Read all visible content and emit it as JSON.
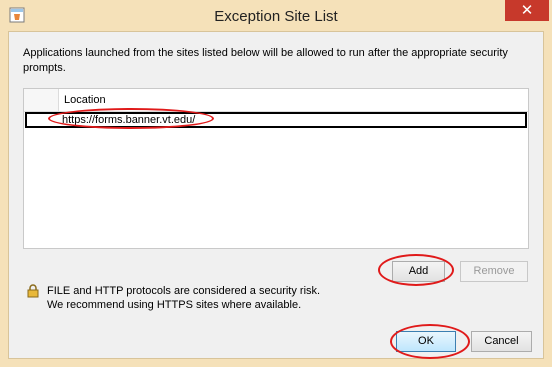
{
  "window": {
    "title": "Exception Site List",
    "close_glyph": "✕",
    "app_icon": "java-app-icon"
  },
  "description": "Applications launched from the sites listed below will be allowed to run after the appropriate security prompts.",
  "table": {
    "columns": [
      "Location"
    ],
    "rows": [
      {
        "location": "https://forms.banner.vt.edu/"
      }
    ]
  },
  "buttons": {
    "add": "Add",
    "remove": "Remove",
    "ok": "OK",
    "cancel": "Cancel"
  },
  "warning": {
    "icon": "padlock-icon",
    "line1": "FILE and HTTP protocols are considered a security risk.",
    "line2": "We recommend using HTTPS sites where available."
  },
  "colors": {
    "frame": "#f5e1b9",
    "close": "#c7392b",
    "annotation": "#e01a1a"
  }
}
